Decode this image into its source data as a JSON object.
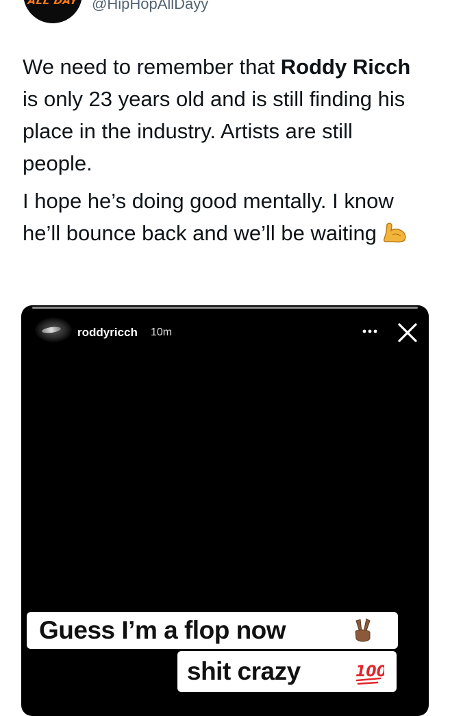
{
  "author": {
    "avatar_text": "ALL DAY",
    "handle": "@HipHopAllDayy"
  },
  "tweet": {
    "p1_a": "We need to remember that ",
    "p1_bold": "Roddy Ricch",
    "p1_b": " is only 23 years old and is still finding his place in the industry. Artists are still people.",
    "p2": "I hope he’s doing good mentally. I know he’ll bounce back and we’ll be waiting",
    "p2_emoji": "flexed-biceps-icon"
  },
  "story": {
    "username": "roddyricch",
    "time": "10m",
    "caption_line1": "Guess I’m a flop now",
    "caption_line1_emoji": "victory-hand-icon",
    "caption_line2": "shit crazy",
    "caption_line2_emoji": "hundred-points-icon"
  },
  "colors": {
    "text": "#0f1419",
    "secondary": "#536471",
    "avatar_logo": "#ff7a1a",
    "story_bg": "#000000"
  }
}
